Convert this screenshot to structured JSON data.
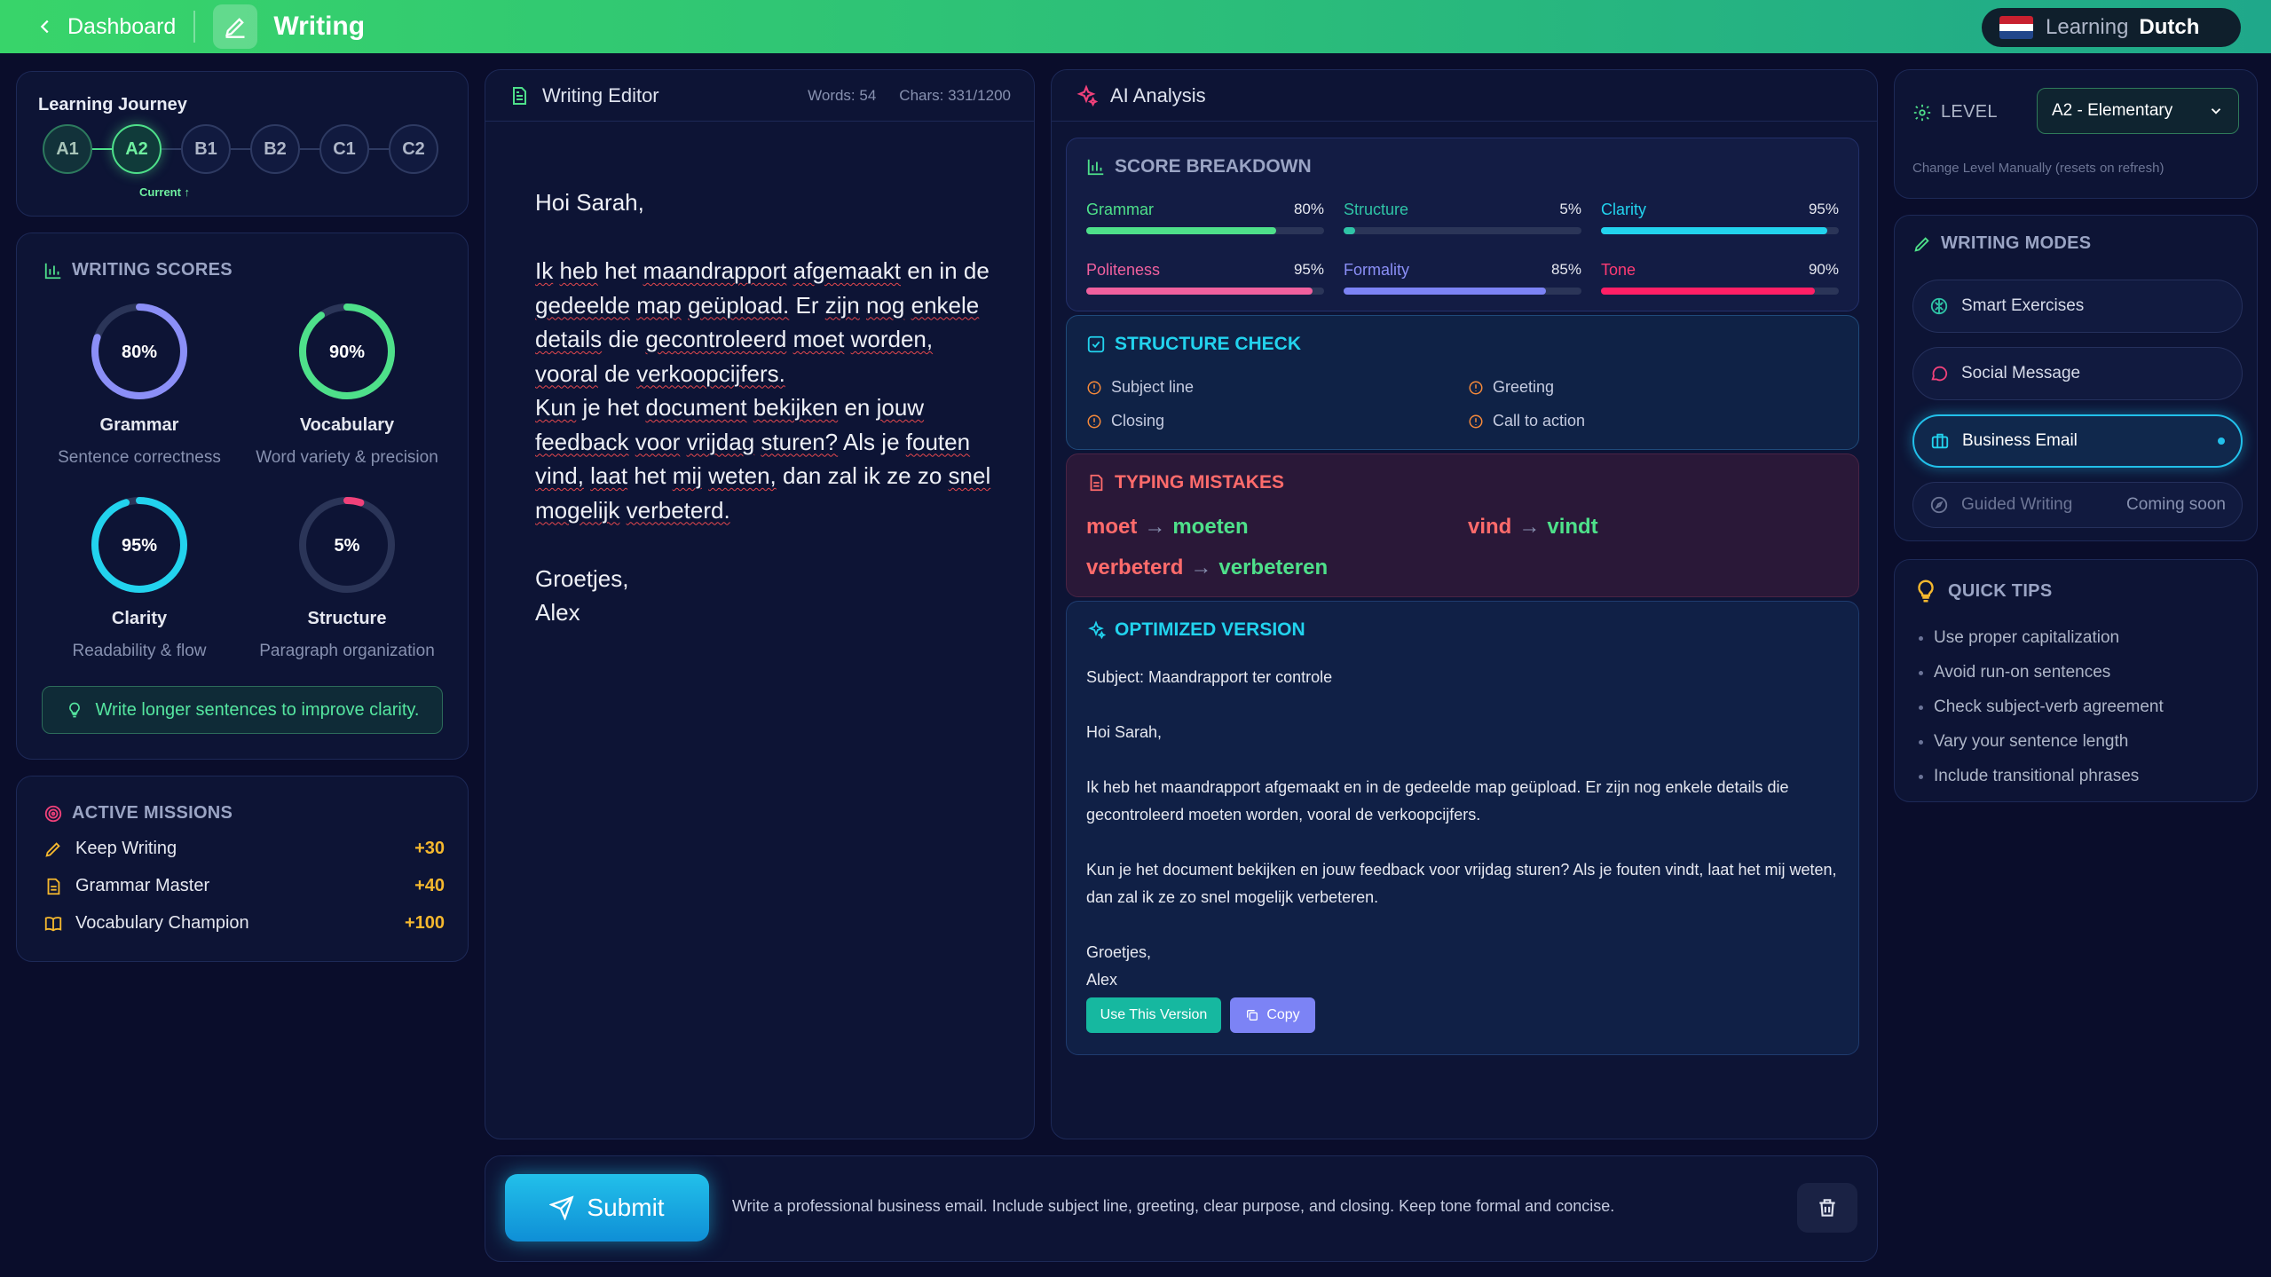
{
  "header": {
    "back_label": "Dashboard",
    "page_title": "Writing",
    "lang_prefix": "Learning",
    "lang_value": "Dutch"
  },
  "journey": {
    "title": "Learning Journey",
    "levels": [
      "A1",
      "A2",
      "B1",
      "B2",
      "C1",
      "C2"
    ],
    "current_label": "Current ↑"
  },
  "scores": {
    "title": "WRITING SCORES",
    "items": [
      {
        "value": 80,
        "label": "80%",
        "name": "Grammar",
        "desc": "Sentence correctness",
        "color": "#8b8ff7"
      },
      {
        "value": 90,
        "label": "90%",
        "name": "Vocabulary",
        "desc": "Word variety & precision",
        "color": "#4ee08a"
      },
      {
        "value": 95,
        "label": "95%",
        "name": "Clarity",
        "desc": "Readability & flow",
        "color": "#22d3ee"
      },
      {
        "value": 5,
        "label": "5%",
        "name": "Structure",
        "desc": "Paragraph organization",
        "color": "#f0417a"
      }
    ],
    "tip": "Write longer sentences to improve clarity."
  },
  "missions": {
    "title": "ACTIVE MISSIONS",
    "items": [
      {
        "name": "Keep Writing",
        "points": "+30"
      },
      {
        "name": "Grammar Master",
        "points": "+40"
      },
      {
        "name": "Vocabulary Champion",
        "points": "+100"
      }
    ]
  },
  "editor": {
    "title": "Writing Editor",
    "words": "Words: 54",
    "chars": "Chars: 331/1200",
    "text": "Hoi Sarah,\n\nIk heb het maandrapport afgemaakt en in de gedeelde map geüpload. Er zijn nog enkele details die gecontroleerd moet worden, vooral de verkoopcijfers.\nKun je het document bekijken en jouw feedback voor vrijdag sturen? Als je fouten vind, laat het mij weten, dan zal ik ze zo snel mogelijk verbeterd.\n\nGroetjes,\nAlex"
  },
  "analysis": {
    "title": "AI Analysis",
    "breakdown_title": "SCORE BREAKDOWN",
    "bars": [
      {
        "name": "Grammar",
        "value": 80,
        "label": "80%",
        "color": "#4ee08a"
      },
      {
        "name": "Structure",
        "value": 5,
        "label": "5%",
        "color": "#2fc4a6"
      },
      {
        "name": "Clarity",
        "value": 95,
        "label": "95%",
        "color": "#22d3ee"
      },
      {
        "name": "Politeness",
        "value": 95,
        "label": "95%",
        "color": "#f0609e"
      },
      {
        "name": "Formality",
        "value": 85,
        "label": "85%",
        "color": "#7c83f5"
      },
      {
        "name": "Tone",
        "value": 90,
        "label": "90%",
        "color": "#ff1f66"
      }
    ],
    "structure_title": "STRUCTURE CHECK",
    "structure_items": [
      "Subject line",
      "Greeting",
      "Closing",
      "Call to action"
    ],
    "mistakes_title": "TYPING MISTAKES",
    "mistakes": [
      {
        "wrong": "moet",
        "right": "moeten"
      },
      {
        "wrong": "vind",
        "right": "vindt"
      },
      {
        "wrong": "verbeterd",
        "right": "verbeteren"
      }
    ],
    "optimized_title": "OPTIMIZED VERSION",
    "optimized_text": "Subject: Maandrapport ter controle\n\nHoi Sarah,\n\nIk heb het maandrapport afgemaakt en in de gedeelde map geüpload. Er zijn nog enkele details die gecontroleerd moeten worden, vooral de verkoopcijfers.\n\nKun je het document bekijken en jouw feedback voor vrijdag sturen? Als je fouten vindt, laat het mij weten, dan zal ik ze zo snel mogelijk verbeteren.\n\nGroetjes,\nAlex",
    "use_label": "Use This Version",
    "copy_label": "Copy"
  },
  "bottom": {
    "submit_label": "Submit",
    "prompt": "Write a professional business email. Include subject line, greeting, clear purpose, and closing. Keep tone formal and concise."
  },
  "level_panel": {
    "title": "LEVEL",
    "selected": "A2 - Elementary",
    "note": "Change Level Manually (resets on refresh)"
  },
  "modes": {
    "title": "WRITING MODES",
    "items": [
      "Smart Exercises",
      "Social Message",
      "Business Email",
      "Guided Writing"
    ],
    "coming_soon": "Coming soon"
  },
  "quick_tips": {
    "title": "QUICK TIPS",
    "items": [
      "Use proper capitalization",
      "Avoid run-on sentences",
      "Check subject-verb agreement",
      "Vary your sentence length",
      "Include transitional phrases"
    ]
  }
}
